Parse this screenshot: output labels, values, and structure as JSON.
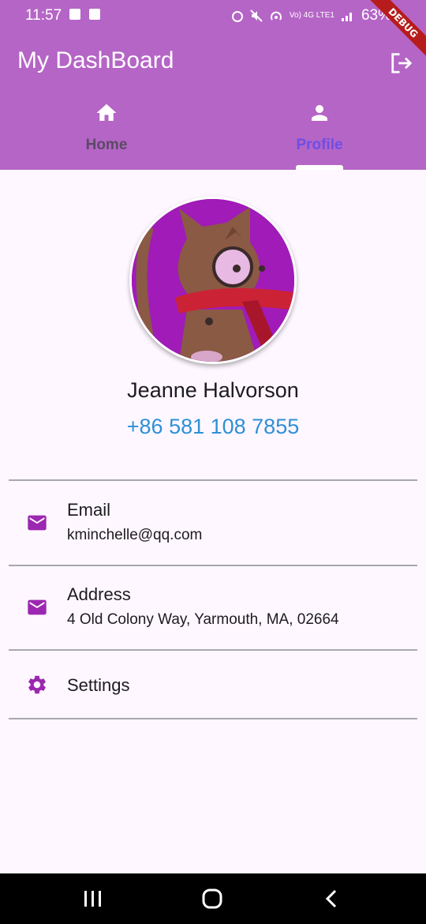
{
  "status_bar": {
    "time": "11:57",
    "network": "Vo) 4G LTE1",
    "battery": "63%"
  },
  "debug_banner": "DEBUG",
  "app_bar": {
    "title": "My DashBoard",
    "logout_icon": "logout-icon",
    "background_color": "#b565c6"
  },
  "tabs": [
    {
      "label": "Home",
      "icon": "home-icon",
      "selected": false
    },
    {
      "label": "Profile",
      "icon": "person-icon",
      "selected": true,
      "color": "#6e4ee6"
    }
  ],
  "profile": {
    "avatar": "cat-avatar",
    "name": "Jeanne Halvorson",
    "phone": "+86 581 108 7855",
    "phone_color": "#2e90d6"
  },
  "items": [
    {
      "icon": "mail-icon",
      "title": "Email",
      "subtitle": "kminchelle@qq.com"
    },
    {
      "icon": "mail-icon",
      "title": "Address",
      "subtitle": "4 Old Colony Way, Yarmouth, MA, 02664"
    },
    {
      "icon": "gear-icon",
      "title": "Settings"
    }
  ],
  "accent_color": "#9c27b0",
  "nav_bar": {
    "icons": [
      "recent-apps-icon",
      "home-circle-icon",
      "back-icon"
    ]
  }
}
